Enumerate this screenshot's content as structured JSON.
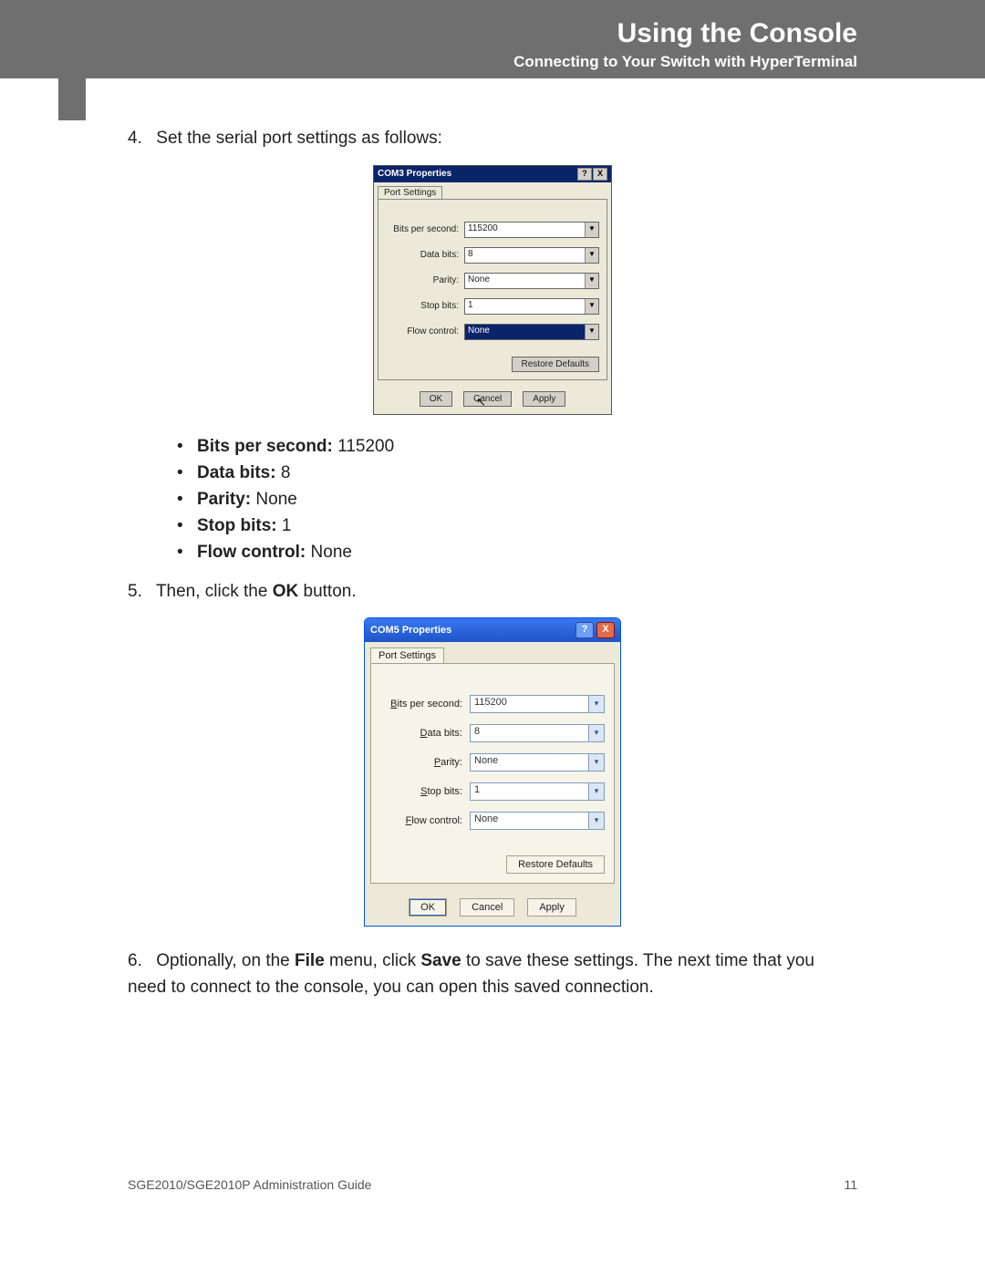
{
  "header": {
    "title": "Using the Console",
    "subtitle": "Connecting to Your Switch with HyperTerminal"
  },
  "steps": {
    "s4": {
      "num": "4.",
      "text": "Set the serial port settings as follows:"
    },
    "s5": {
      "num": "5.",
      "pre": "Then, click the ",
      "bold": "OK",
      "post": " button."
    },
    "s6": {
      "num": "6.",
      "pre": "Optionally, on the ",
      "w1": "File",
      "mid1": " menu, click ",
      "w2": "Save",
      "post": " to save these settings. The next time that you need to connect to the console, you can open this saved connection."
    }
  },
  "bullets": {
    "b1": {
      "label": "Bits per second: ",
      "value": "115200"
    },
    "b2": {
      "label": "Data bits: ",
      "value": "8"
    },
    "b3": {
      "label": "Parity: ",
      "value": "None"
    },
    "b4": {
      "label": "Stop bits: ",
      "value": "1"
    },
    "b5": {
      "label": "Flow control: ",
      "value": "None"
    }
  },
  "dlg1": {
    "title": "COM3 Properties",
    "tab": "Port Settings",
    "labels": {
      "bps": "Bits per second:",
      "db": "Data bits:",
      "par": "Parity:",
      "sb": "Stop bits:",
      "fc": "Flow control:"
    },
    "values": {
      "bps": "115200",
      "db": "8",
      "par": "None",
      "sb": "1",
      "fc": "None"
    },
    "restore": "Restore Defaults",
    "ok": "OK",
    "cancel": "Cancel",
    "apply": "Apply",
    "help": "?",
    "close": "X"
  },
  "dlg2": {
    "title": "COM5 Properties",
    "tab": "Port Settings",
    "labels": {
      "bps_u": "B",
      "bps_r": "its per second:",
      "db_u": "D",
      "db_r": "ata bits:",
      "par_u": "P",
      "par_r": "arity:",
      "sb_u": "S",
      "sb_r": "top bits:",
      "fc_u": "F",
      "fc_r": "low control:",
      "restore_u": "R",
      "restore_r": "estore Defaults",
      "apply_u": "A",
      "apply_r": "pply"
    },
    "values": {
      "bps": "115200",
      "db": "8",
      "par": "None",
      "sb": "1",
      "fc": "None"
    },
    "ok": "OK",
    "cancel": "Cancel",
    "help": "?",
    "close": "X"
  },
  "footer": {
    "left": "SGE2010/SGE2010P Administration Guide",
    "right": "11"
  }
}
